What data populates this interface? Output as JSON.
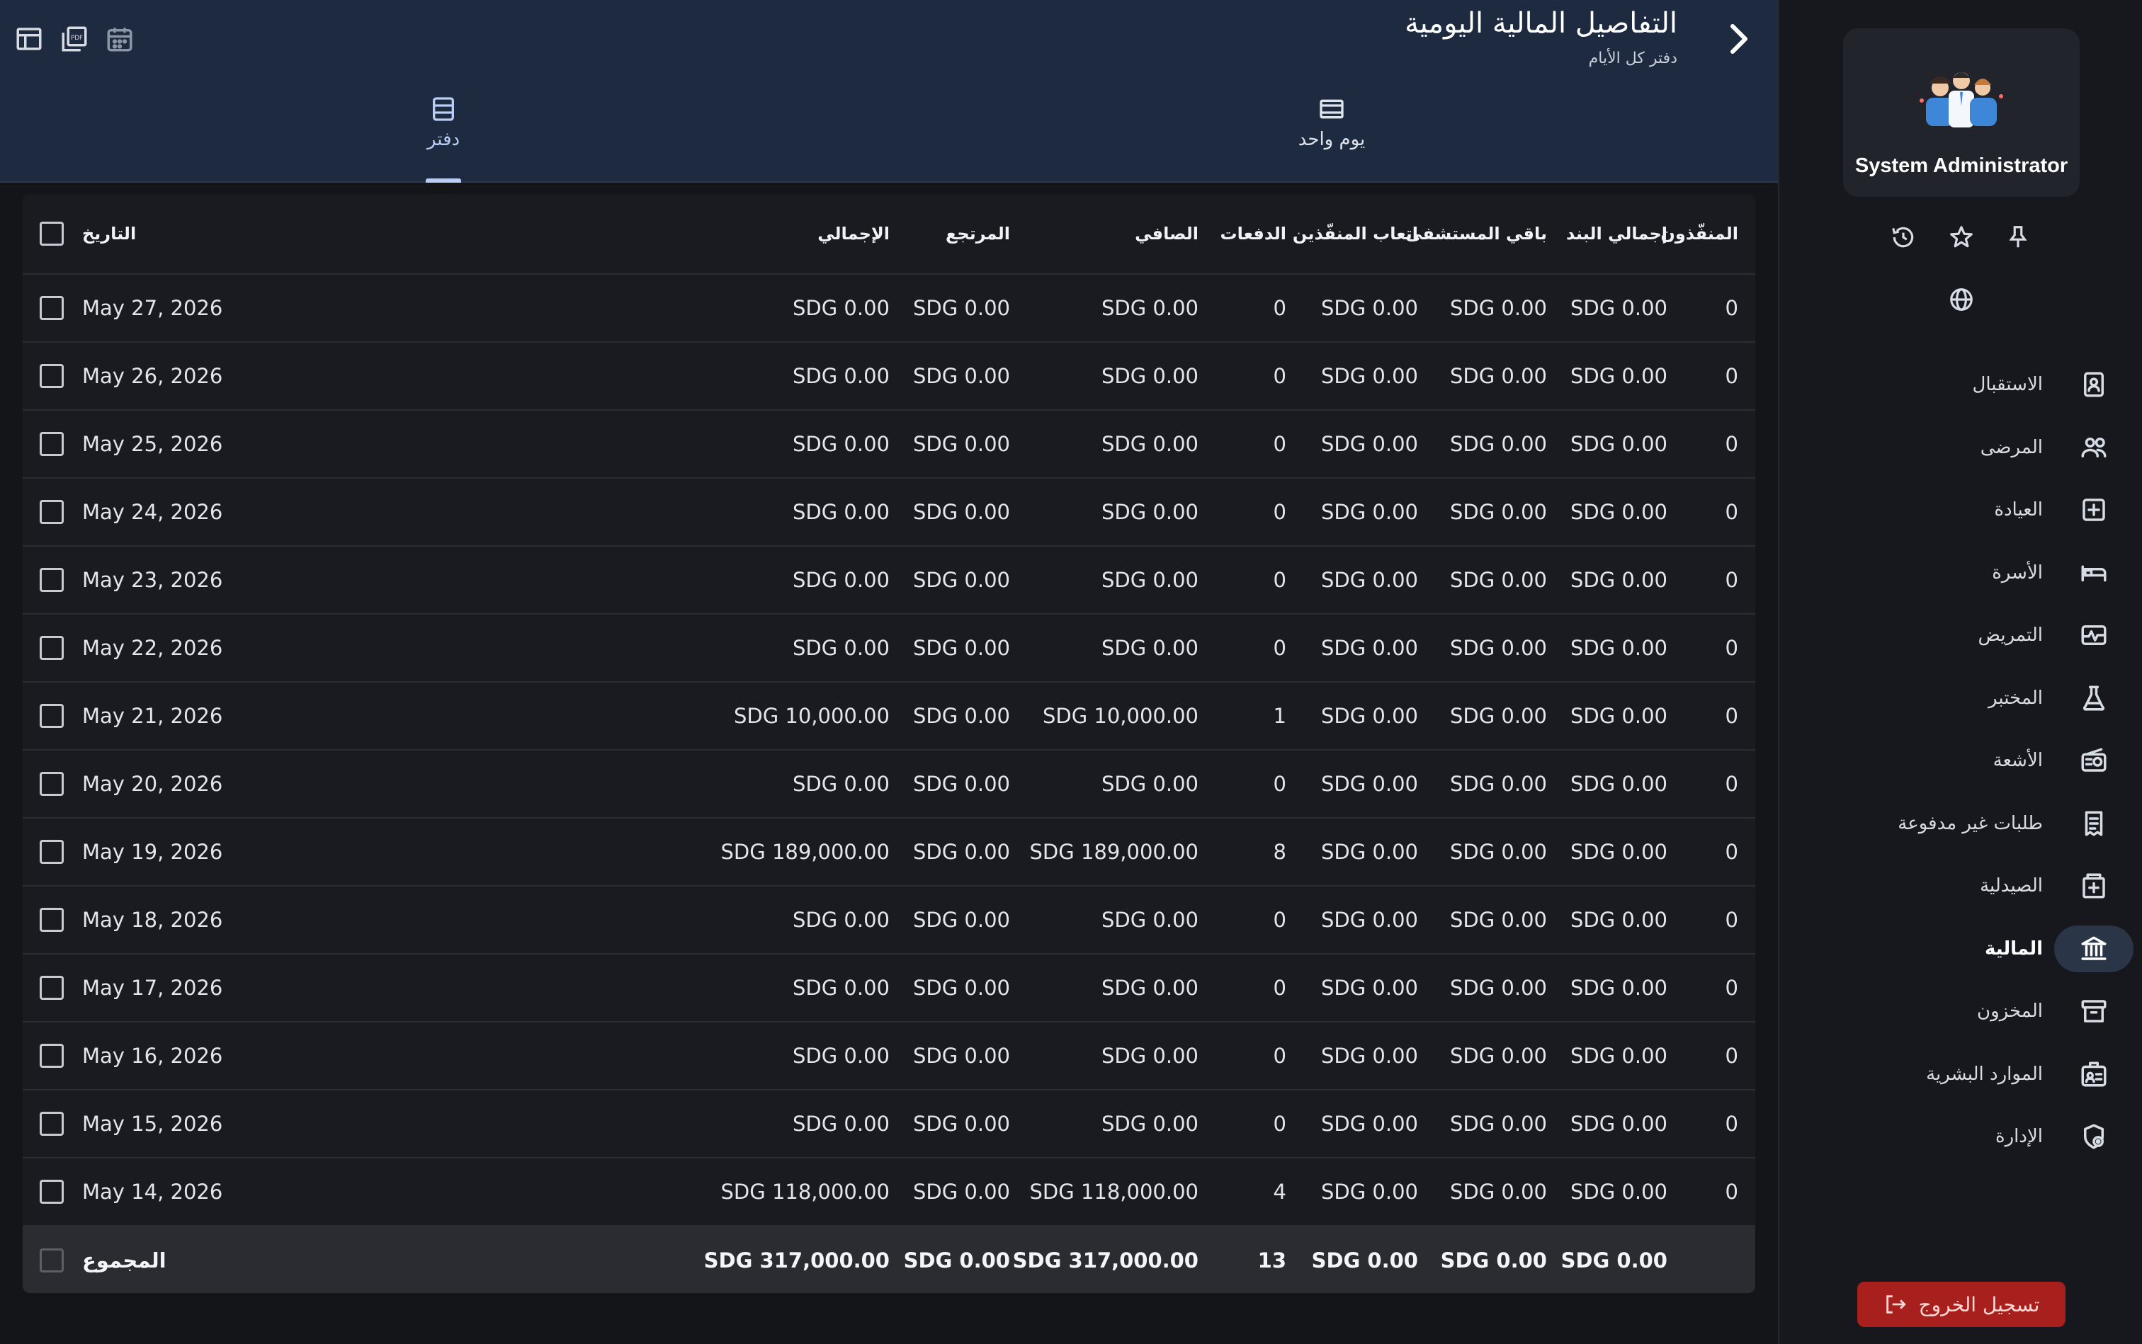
{
  "app": {
    "user_name": "System Administrator",
    "colors": {
      "accent": "#b9cdf5",
      "header_bg": "#1e2a3f",
      "logout": "#a7201e",
      "active_nav_bg": "#2b3548"
    }
  },
  "sidebar": {
    "quick_icons": [
      "history-icon",
      "star-icon",
      "pin-icon",
      "globe-icon"
    ],
    "items": [
      {
        "label": "الاستقبال",
        "icon": "reception-icon",
        "active": false
      },
      {
        "label": "المرضى",
        "icon": "patients-icon",
        "active": false
      },
      {
        "label": "العيادة",
        "icon": "clinic-icon",
        "active": false
      },
      {
        "label": "الأسرة",
        "icon": "bed-icon",
        "active": false
      },
      {
        "label": "التمريض",
        "icon": "nursing-icon",
        "active": false
      },
      {
        "label": "المختبر",
        "icon": "lab-flask-icon",
        "active": false
      },
      {
        "label": "الأشعة",
        "icon": "radiology-icon",
        "active": false
      },
      {
        "label": "طلبات غير مدفوعة",
        "icon": "receipt-icon",
        "active": false
      },
      {
        "label": "الصيدلية",
        "icon": "pharmacy-icon",
        "active": false
      },
      {
        "label": "المالية",
        "icon": "bank-icon",
        "active": true
      },
      {
        "label": "المخزون",
        "icon": "archive-icon",
        "active": false
      },
      {
        "label": "الموارد البشرية",
        "icon": "hr-badge-icon",
        "active": false
      },
      {
        "label": "الإدارة",
        "icon": "admin-shield-icon",
        "active": false
      }
    ],
    "logout_label": "تسجيل الخروج"
  },
  "header": {
    "title": "التفاصيل المالية اليومية",
    "subtitle": "دفتر كل الأيام",
    "tools": [
      "table-view-icon",
      "pdf-icon",
      "calendar-icon"
    ],
    "tabs": [
      {
        "label": "يوم واحد",
        "icon": "single-day-icon",
        "active": false
      },
      {
        "label": "دفتر",
        "icon": "ledger-icon",
        "active": true
      }
    ]
  },
  "table": {
    "columns": {
      "date": "التاريخ",
      "total": "الإجمالي",
      "refund": "المرتجع",
      "net": "الصافي",
      "payments": "الدفعات",
      "fees": "اتعاب المنفّذين",
      "hospital_remain": "باقي المستشفى",
      "item_total": "إجمالي البند",
      "executors": "المنفّذون"
    },
    "rows": [
      {
        "date": "May 27, 2026",
        "total": "SDG 0.00",
        "refund": "SDG 0.00",
        "net": "SDG 0.00",
        "payments": "0",
        "fees": "SDG 0.00",
        "hospital_remain": "SDG 0.00",
        "item_total": "SDG 0.00",
        "executors": "0"
      },
      {
        "date": "May 26, 2026",
        "total": "SDG 0.00",
        "refund": "SDG 0.00",
        "net": "SDG 0.00",
        "payments": "0",
        "fees": "SDG 0.00",
        "hospital_remain": "SDG 0.00",
        "item_total": "SDG 0.00",
        "executors": "0"
      },
      {
        "date": "May 25, 2026",
        "total": "SDG 0.00",
        "refund": "SDG 0.00",
        "net": "SDG 0.00",
        "payments": "0",
        "fees": "SDG 0.00",
        "hospital_remain": "SDG 0.00",
        "item_total": "SDG 0.00",
        "executors": "0"
      },
      {
        "date": "May 24, 2026",
        "total": "SDG 0.00",
        "refund": "SDG 0.00",
        "net": "SDG 0.00",
        "payments": "0",
        "fees": "SDG 0.00",
        "hospital_remain": "SDG 0.00",
        "item_total": "SDG 0.00",
        "executors": "0"
      },
      {
        "date": "May 23, 2026",
        "total": "SDG 0.00",
        "refund": "SDG 0.00",
        "net": "SDG 0.00",
        "payments": "0",
        "fees": "SDG 0.00",
        "hospital_remain": "SDG 0.00",
        "item_total": "SDG 0.00",
        "executors": "0"
      },
      {
        "date": "May 22, 2026",
        "total": "SDG 0.00",
        "refund": "SDG 0.00",
        "net": "SDG 0.00",
        "payments": "0",
        "fees": "SDG 0.00",
        "hospital_remain": "SDG 0.00",
        "item_total": "SDG 0.00",
        "executors": "0"
      },
      {
        "date": "May 21, 2026",
        "total": "SDG 10,000.00",
        "refund": "SDG 0.00",
        "net": "SDG 10,000.00",
        "payments": "1",
        "fees": "SDG 0.00",
        "hospital_remain": "SDG 0.00",
        "item_total": "SDG 0.00",
        "executors": "0"
      },
      {
        "date": "May 20, 2026",
        "total": "SDG 0.00",
        "refund": "SDG 0.00",
        "net": "SDG 0.00",
        "payments": "0",
        "fees": "SDG 0.00",
        "hospital_remain": "SDG 0.00",
        "item_total": "SDG 0.00",
        "executors": "0"
      },
      {
        "date": "May 19, 2026",
        "total": "SDG 189,000.00",
        "refund": "SDG 0.00",
        "net": "SDG 189,000.00",
        "payments": "8",
        "fees": "SDG 0.00",
        "hospital_remain": "SDG 0.00",
        "item_total": "SDG 0.00",
        "executors": "0"
      },
      {
        "date": "May 18, 2026",
        "total": "SDG 0.00",
        "refund": "SDG 0.00",
        "net": "SDG 0.00",
        "payments": "0",
        "fees": "SDG 0.00",
        "hospital_remain": "SDG 0.00",
        "item_total": "SDG 0.00",
        "executors": "0"
      },
      {
        "date": "May 17, 2026",
        "total": "SDG 0.00",
        "refund": "SDG 0.00",
        "net": "SDG 0.00",
        "payments": "0",
        "fees": "SDG 0.00",
        "hospital_remain": "SDG 0.00",
        "item_total": "SDG 0.00",
        "executors": "0"
      },
      {
        "date": "May 16, 2026",
        "total": "SDG 0.00",
        "refund": "SDG 0.00",
        "net": "SDG 0.00",
        "payments": "0",
        "fees": "SDG 0.00",
        "hospital_remain": "SDG 0.00",
        "item_total": "SDG 0.00",
        "executors": "0"
      },
      {
        "date": "May 15, 2026",
        "total": "SDG 0.00",
        "refund": "SDG 0.00",
        "net": "SDG 0.00",
        "payments": "0",
        "fees": "SDG 0.00",
        "hospital_remain": "SDG 0.00",
        "item_total": "SDG 0.00",
        "executors": "0"
      },
      {
        "date": "May 14, 2026",
        "total": "SDG 118,000.00",
        "refund": "SDG 0.00",
        "net": "SDG 118,000.00",
        "payments": "4",
        "fees": "SDG 0.00",
        "hospital_remain": "SDG 0.00",
        "item_total": "SDG 0.00",
        "executors": "0"
      }
    ],
    "totals": {
      "label": "المجموع",
      "total": "SDG 317,000.00",
      "refund": "SDG 0.00",
      "net": "SDG 317,000.00",
      "payments": "13",
      "fees": "SDG 0.00",
      "hospital_remain": "SDG 0.00",
      "item_total": "SDG 0.00"
    }
  }
}
